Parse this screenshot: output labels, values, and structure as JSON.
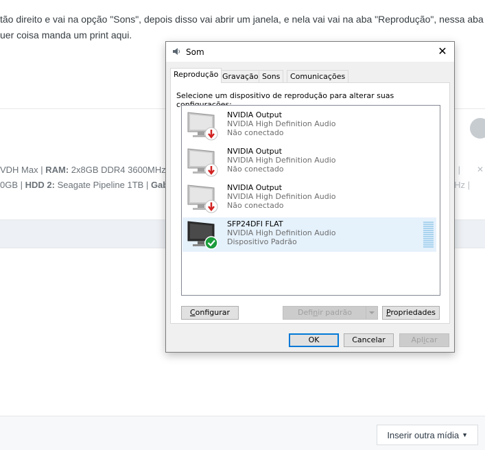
{
  "page": {
    "text_line1": "tão direito e vai na opção \"Sons\", depois disso vai abrir um janela, e nela vai vai na aba \"Reprodução\", nessa aba",
    "text_line2": "uer coisa manda um print aqui.",
    "sig1": {
      "a": "VDH Max | ",
      "b": "RAM:",
      "c": " 2x8GB DDR4 3600MHz"
    },
    "sig2": {
      "a": "0GB | ",
      "b": "HDD 2:",
      "c": " Seagate Pipeline 1TB | ",
      "d": "Gab"
    },
    "sig_right1": "|",
    "sig_right2": "Hz |",
    "insert_media": "Inserir outra mídia"
  },
  "dialog": {
    "title": "Som",
    "close": "✕",
    "tabs": [
      "Reprodução",
      "Gravação",
      "Sons",
      "Comunicações"
    ],
    "instruction": "Selecione um dispositivo de reprodução para alterar suas configurações:",
    "devices": [
      {
        "name": "NVIDIA Output",
        "driver": "NVIDIA High Definition Audio",
        "status": "Não conectado"
      },
      {
        "name": "NVIDIA Output",
        "driver": "NVIDIA High Definition Audio",
        "status": "Não conectado"
      },
      {
        "name": "NVIDIA Output",
        "driver": "NVIDIA High Definition Audio",
        "status": "Não conectado"
      },
      {
        "name": "SFP24DFI FLAT",
        "driver": "NVIDIA High Definition Audio",
        "status": "Dispositivo Padrão"
      }
    ],
    "buttons": {
      "configure": {
        "first": "C",
        "rest": "onfigurar"
      },
      "set_default": {
        "pre": "Defi",
        "u": "n",
        "rest": "ir padrão"
      },
      "properties": {
        "first": "P",
        "rest": "ropriedades"
      },
      "ok": "OK",
      "cancel": "Cancelar",
      "apply": {
        "pre": "Apl",
        "u": "i",
        "rest": "car"
      }
    }
  }
}
